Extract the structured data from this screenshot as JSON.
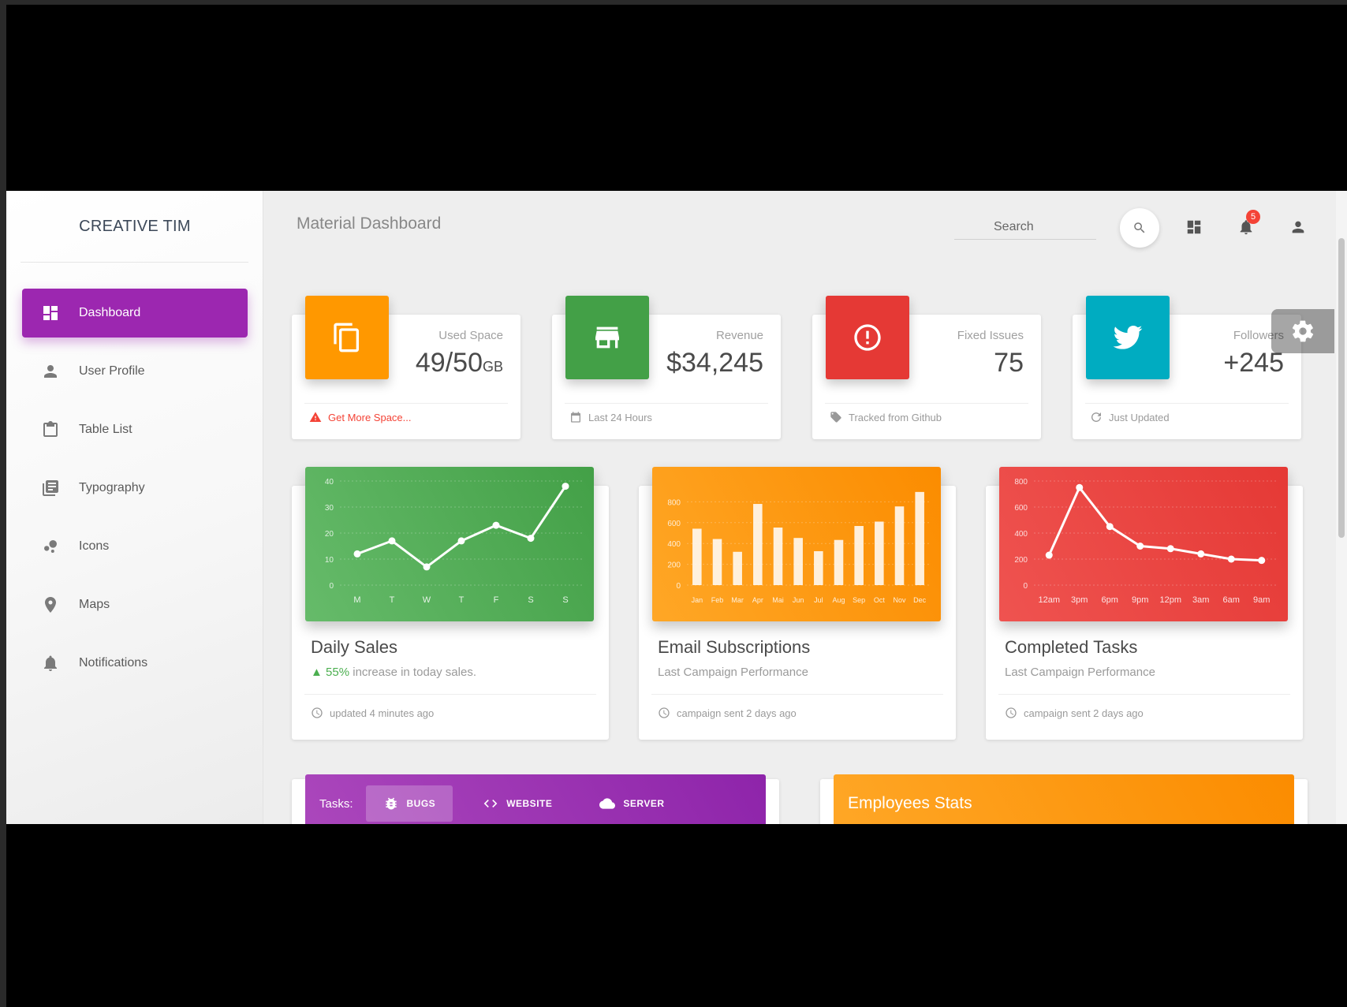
{
  "brand": "CREATIVE TIM",
  "page_title": "Material Dashboard",
  "search": {
    "placeholder": "Search"
  },
  "notification_count": "5",
  "sidebar": {
    "items": [
      {
        "label": "Dashboard",
        "icon": "dashboard-icon",
        "active": true
      },
      {
        "label": "User Profile",
        "icon": "person-icon"
      },
      {
        "label": "Table List",
        "icon": "clipboard-icon"
      },
      {
        "label": "Typography",
        "icon": "library-books-icon"
      },
      {
        "label": "Icons",
        "icon": "bubble-chart-icon"
      },
      {
        "label": "Maps",
        "icon": "location-icon"
      },
      {
        "label": "Notifications",
        "icon": "bell-icon"
      }
    ]
  },
  "stats": [
    {
      "label": "Used Space",
      "value": "49/50",
      "unit": "GB",
      "footer": "Get More Space...",
      "color": "#ff9800",
      "icon": "content-copy-icon"
    },
    {
      "label": "Revenue",
      "value": "$34,245",
      "footer": "Last 24 Hours",
      "color": "#43a047",
      "icon": "store-icon"
    },
    {
      "label": "Fixed Issues",
      "value": "75",
      "footer": "Tracked from Github",
      "color": "#e53935",
      "icon": "info-icon"
    },
    {
      "label": "Followers",
      "value": "+245",
      "footer": "Just Updated",
      "color": "#00acc1",
      "icon": "twitter-icon"
    }
  ],
  "charts": [
    {
      "title": "Daily Sales",
      "subtitle_pct": "55%",
      "subtitle_rest": " increase in today sales.",
      "footer": "updated 4 minutes ago",
      "color": "#4caf50"
    },
    {
      "title": "Email Subscriptions",
      "subtitle": "Last Campaign Performance",
      "footer": "campaign sent 2 days ago",
      "color": "#ff9800"
    },
    {
      "title": "Completed Tasks",
      "subtitle": "Last Campaign Performance",
      "footer": "campaign sent 2 days ago",
      "color": "#f44336"
    }
  ],
  "chart_data": [
    {
      "type": "line",
      "categories": [
        "M",
        "T",
        "W",
        "T",
        "F",
        "S",
        "S"
      ],
      "values": [
        12,
        17,
        7,
        17,
        23,
        18,
        38
      ],
      "ylim": [
        0,
        40
      ],
      "yticks": [
        "0",
        "10",
        "20",
        "30",
        "40"
      ]
    },
    {
      "type": "bar",
      "categories": [
        "Jan",
        "Feb",
        "Mar",
        "Apr",
        "Mai",
        "Jun",
        "Jul",
        "Aug",
        "Sep",
        "Oct",
        "Nov",
        "Dec"
      ],
      "values": [
        542,
        443,
        320,
        780,
        553,
        453,
        326,
        434,
        568,
        610,
        756,
        895
      ],
      "ylim": [
        0,
        1000
      ],
      "yticks": [
        "0",
        "200",
        "400",
        "600",
        "800"
      ]
    },
    {
      "type": "line",
      "categories": [
        "12am",
        "3pm",
        "6pm",
        "9pm",
        "12pm",
        "3am",
        "6am",
        "9am"
      ],
      "values": [
        230,
        750,
        450,
        300,
        280,
        240,
        200,
        190
      ],
      "ylim": [
        0,
        800
      ],
      "yticks": [
        "0",
        "200",
        "400",
        "600",
        "800"
      ]
    }
  ],
  "tasks": {
    "label": "Tasks:",
    "tabs": [
      {
        "label": "BUGS",
        "icon": "bug-icon",
        "active": true
      },
      {
        "label": "WEBSITE",
        "icon": "code-icon"
      },
      {
        "label": "SERVER",
        "icon": "cloud-icon"
      }
    ]
  },
  "employees": {
    "title": "Employees Stats"
  }
}
